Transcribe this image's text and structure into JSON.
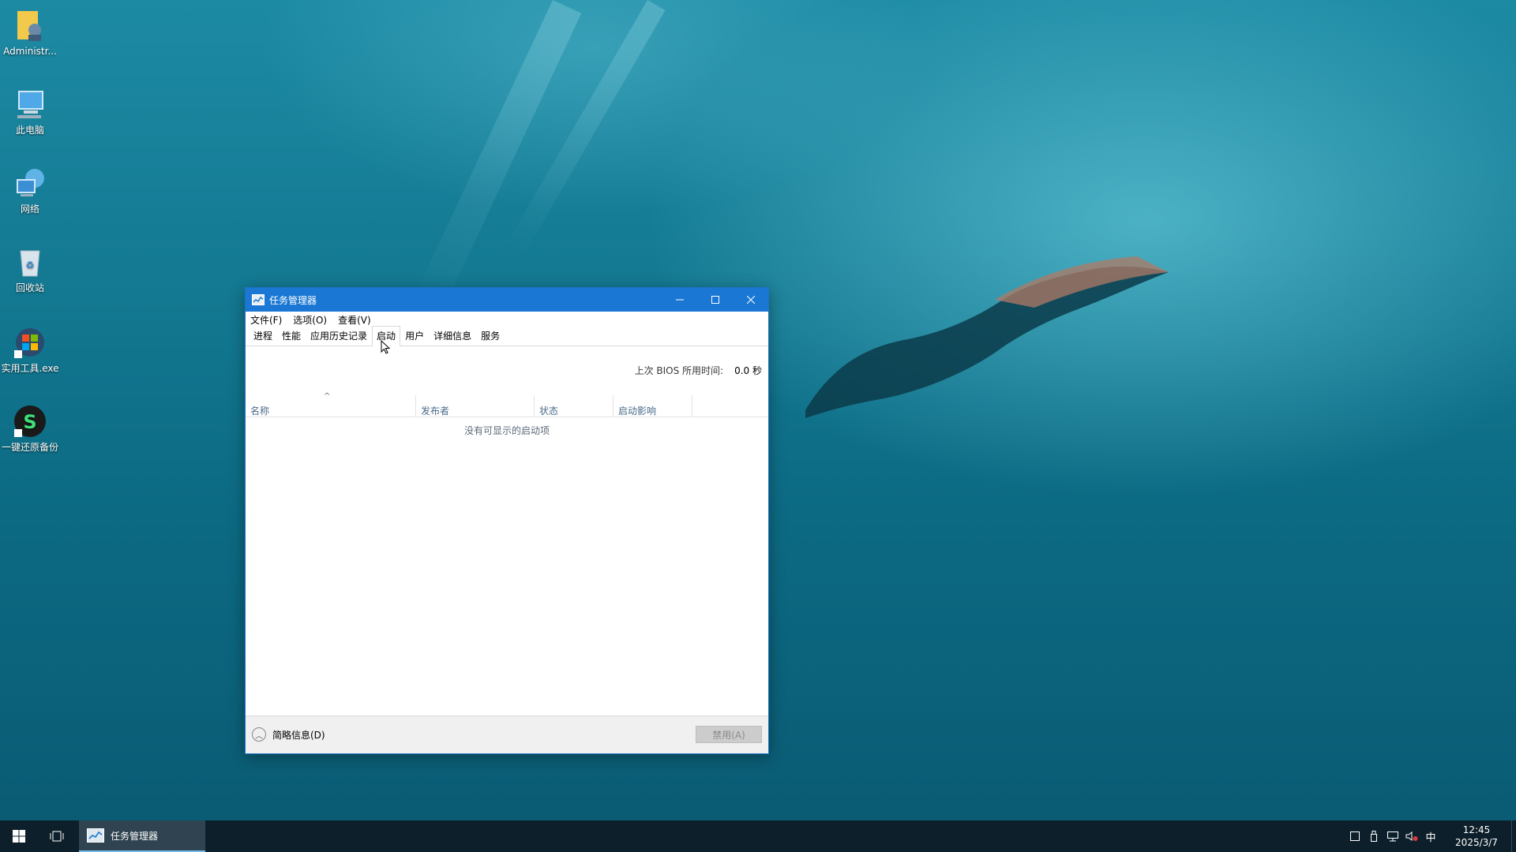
{
  "desktop": {
    "icons": [
      {
        "label": "Administr...",
        "icon": "user-folder-icon"
      },
      {
        "label": "此电脑",
        "icon": "this-pc-icon"
      },
      {
        "label": "网络",
        "icon": "network-icon"
      },
      {
        "label": "回收站",
        "icon": "recycle-bin-icon"
      },
      {
        "label": "实用工具.exe",
        "icon": "windows-tool-icon"
      },
      {
        "label": "一键还原备份",
        "icon": "restore-backup-icon"
      }
    ]
  },
  "window": {
    "title": "任务管理器",
    "menu": [
      "文件(F)",
      "选项(O)",
      "查看(V)"
    ],
    "tabs": [
      "进程",
      "性能",
      "应用历史记录",
      "启动",
      "用户",
      "详细信息",
      "服务"
    ],
    "active_tab": "启动",
    "bios_label": "上次 BIOS 所用时间:",
    "bios_value": "0.0 秒",
    "columns": [
      "名称",
      "发布者",
      "状态",
      "启动影响"
    ],
    "empty_message": "没有可显示的启动项",
    "fewer_details": "简略信息(D)",
    "disable_button": "禁用(A)"
  },
  "taskbar": {
    "app_label": "任务管理器",
    "ime": "中",
    "time": "12:45",
    "date": "2025/3/7"
  },
  "colors": {
    "titlebar": "#1a78d4",
    "taskbar": "#0d1f2a",
    "taskbar_active": "#2f4450",
    "accent": "#76b9ed"
  }
}
